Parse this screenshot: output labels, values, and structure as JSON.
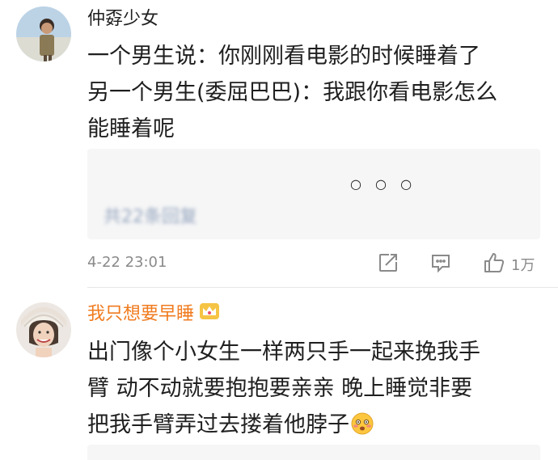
{
  "comments": [
    {
      "username": "仲孬少女",
      "text_lines": [
        "一个男生说：你刚刚看电影的时候睡着了",
        "另一个男生(委屈巴巴)：我跟你看电影怎么",
        "能睡着呢"
      ],
      "reply_box": {
        "more": "○ ○ ○",
        "reply_count": "共22条回复"
      },
      "timestamp": "4-22 23:01",
      "like_count": "1万",
      "icons": [
        "share-icon",
        "comment-icon",
        "like-icon"
      ]
    },
    {
      "username": "我只想要早睡",
      "username_color": "#f07b1f",
      "badge": "crown-icon",
      "text_lines": [
        "出门像个小女生一样两只手一起来挽我手",
        "臂  动不动就要抱抱要亲亲  晚上睡觉非要",
        "把我手臂弄过去搂着他脖子"
      ],
      "trailing_emoji": "embarrassed-face-icon"
    }
  ]
}
